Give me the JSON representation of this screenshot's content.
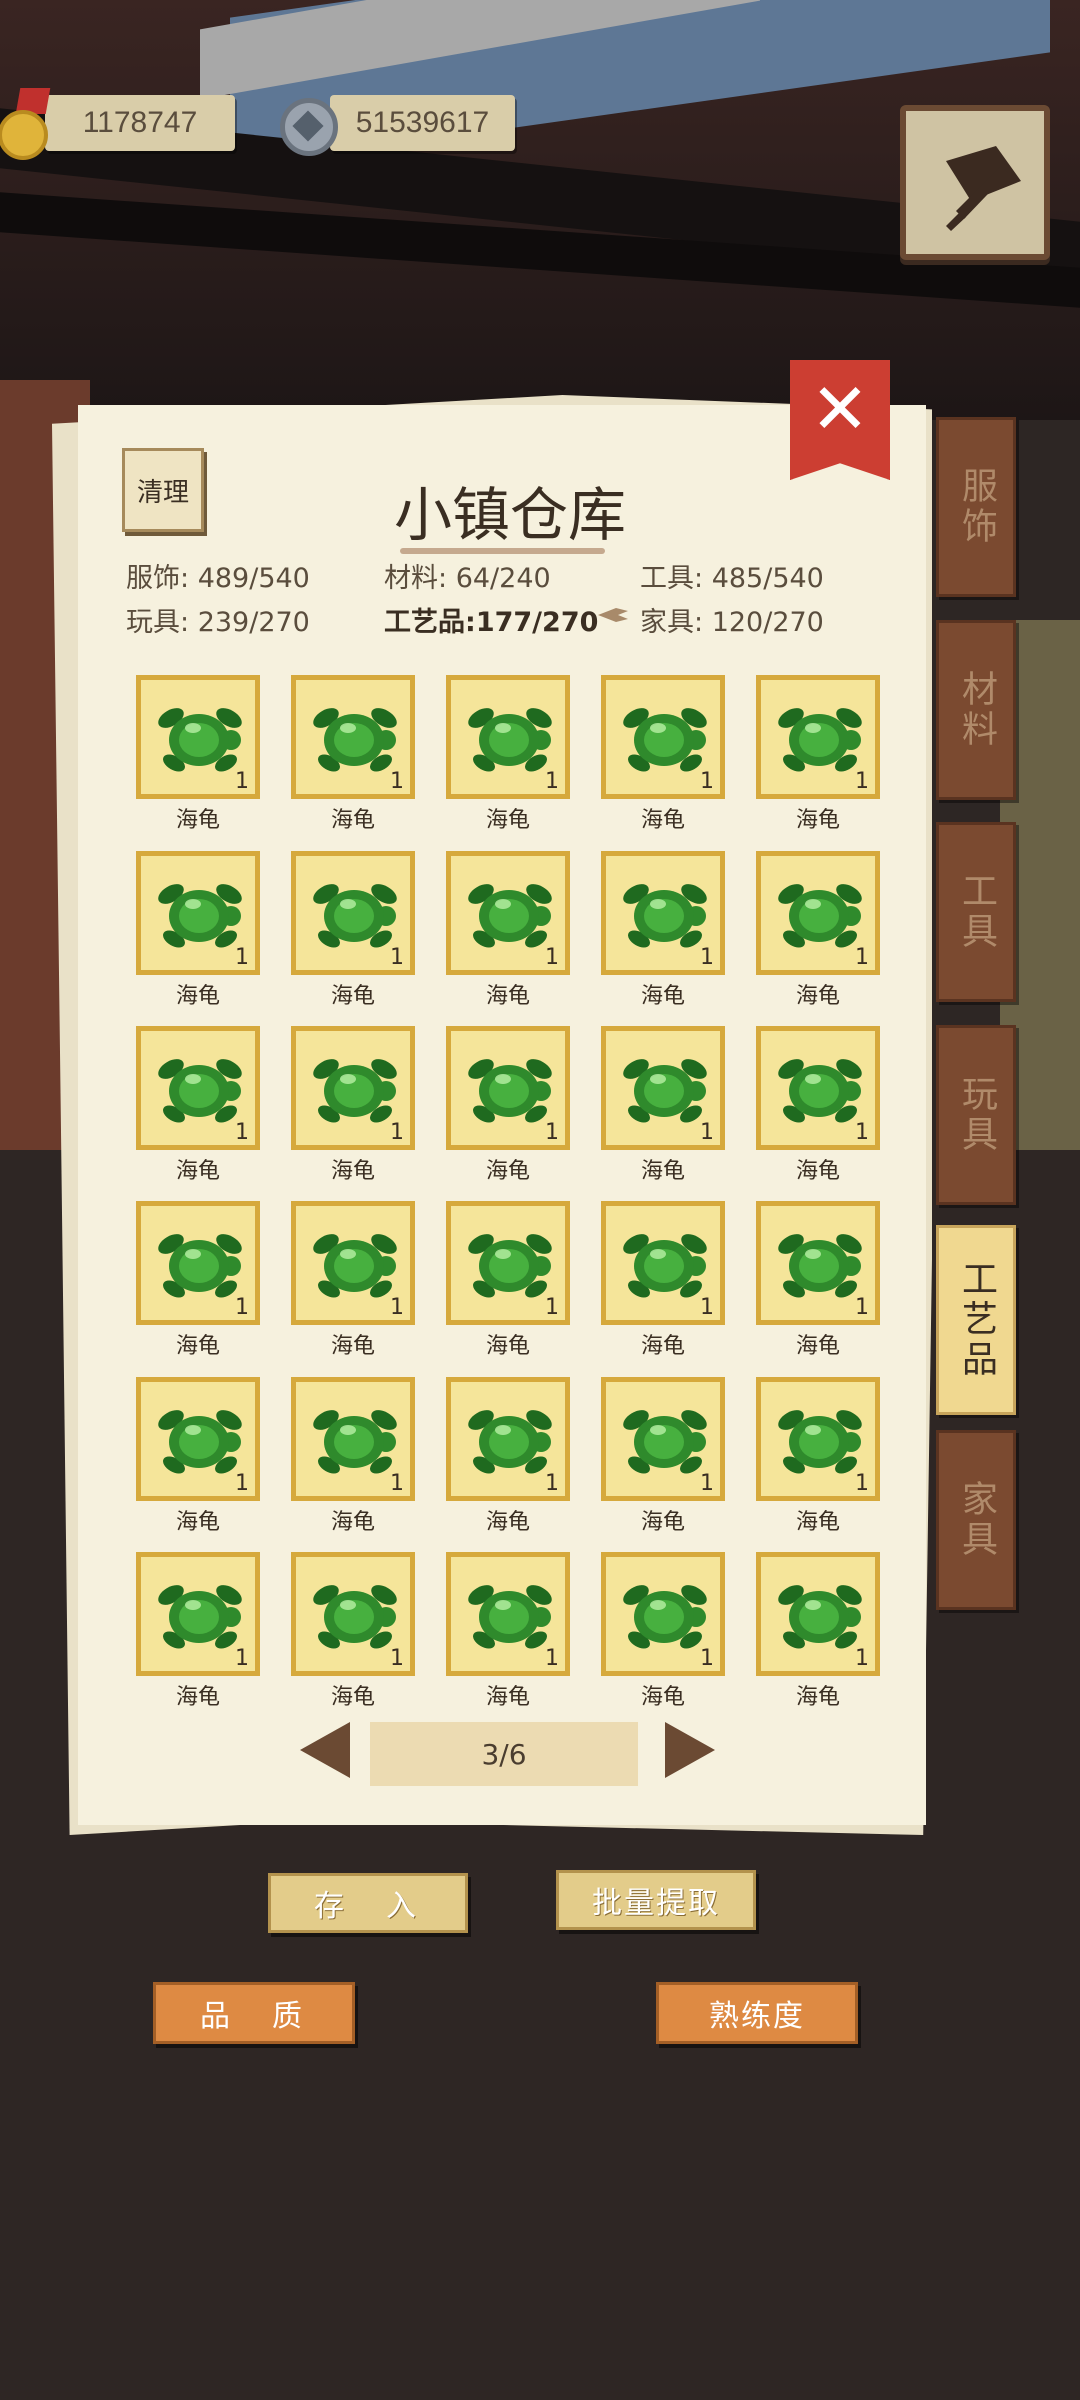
{
  "currency": {
    "coins": "1178747",
    "gems": "51539617"
  },
  "panel": {
    "title": "小镇仓库",
    "clean_label": "清理",
    "close_label": "✕"
  },
  "stats": [
    {
      "label": "服饰",
      "value": "489/540"
    },
    {
      "label": "材料",
      "value": "64/240"
    },
    {
      "label": "工具",
      "value": "485/540"
    },
    {
      "label": "玩具",
      "value": "239/270"
    },
    {
      "label": "工艺品",
      "value": "177/270"
    },
    {
      "label": "家具",
      "value": "120/270"
    }
  ],
  "item": {
    "name": "海龟",
    "count": "1",
    "icon": "sea-turtle-icon",
    "color": "#2f8a2c"
  },
  "pagination": {
    "current": "3/6"
  },
  "tabs": [
    "服饰",
    "材料",
    "工具",
    "玩具",
    "工艺品",
    "家具"
  ],
  "active_tab": "工艺品",
  "buttons": {
    "deposit": "存　入",
    "batch_extract": "批量提取",
    "quality": "品　质",
    "proficiency": "熟练度"
  },
  "colors": {
    "cell_bg": "#f5e59a",
    "cell_border": "#d6a93c",
    "tab": "#7b4a30",
    "tab_active": "#f0d890",
    "orange": "#de8a43"
  }
}
